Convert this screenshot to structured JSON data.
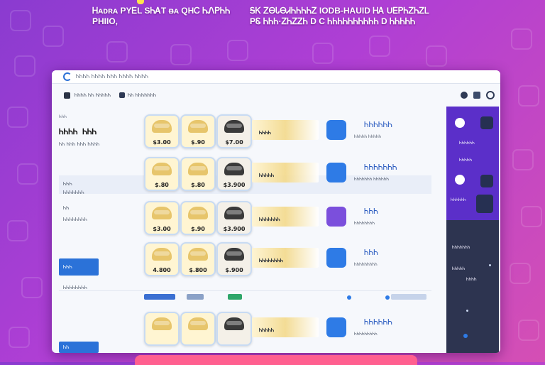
{
  "headline": {
    "left": "Ꮋᴀᴅʀᴀ PYᎬL SᏂᎪT ᴃᴀ QHᏟ ᏂᏁᏢᏂᏂ\nPHIIO,",
    "right": "ᎦᏦ ᏃᎾᏓᎾᏗᏂᏂᏂᏂᏃ   IODB-HAUID ᎻᎪ UᎬᏢᏂᏃᏂᏃᏞ\nPᏋ ᏂᏂᏂ·ᏃᏂᏃᏃᏂ D  C ᏂᏂᏂᏂᏂᏂᏂᏂᏂᏂ D ᏂᏂᏂᏂᏂ"
  },
  "window": {
    "title": "ᏂᏂᏂᏂ ᏂᏂᏂᏂ ᏂᏂᏂ ᏂᏂᏂᏂ ᏂᏂᏂᏂ",
    "toolbar_crumb": "ᏂᏂᏂᏂ  ᏂᏂ  ᏂᏂᏂᏂᏂ",
    "toolbar_label": "ᏂᏂ ᏂᏂᏂᏂᏂᏂᏂ"
  },
  "left": {
    "top_label": "ᏂᏂᏂ",
    "title": "ᏂᏂᏂᏂ ᏂᏂᏂ",
    "subtitle": "ᏂᏂ ᏂᏂᏂ ᏂᏂᏂ ᏂᏂᏂᏂ",
    "label2": "ᏂᏂᏂ",
    "sub2": "ᏂᏂᏂᏂᏂᏂᏂ",
    "label3": "ᏂᏂ",
    "sub3": "ᏂᏂᏂᏂᏂᏂᏂᏂ",
    "button": "ᏂᏂᏂ",
    "button2": "ᏂᏂ",
    "sub4": "ᏂᏂᏂᏂᏂᏂᏂᏂ"
  },
  "rows": [
    {
      "prices": [
        "$3.00",
        "$.90",
        "$7.00"
      ],
      "headline": "ᏂᏂᏂᏂ",
      "big": "ᏂᏂᏂᏂᏂᏂ",
      "small": "ᏂᏂᏂᏂᏂ ᏂᏂᏂᏂᏂ"
    },
    {
      "prices": [
        "$.80",
        "$.80",
        "$3.900"
      ],
      "headline": "ᏂᏂᏂᏂᏂ",
      "big": "ᏂᏂᏂᏂᏂᏂᏂ",
      "small": "ᏂᏂᏂᏂᏂᏂᏂ ᏂᏂᏂᏂᏂᏂ"
    },
    {
      "prices": [
        "$3.00",
        "$.90",
        "$3.900"
      ],
      "headline": "ᏂᏂᏂᏂᏂᏂᏂ",
      "big": "ᏂᏂᏂ",
      "small": "ᏂᏂᏂᏂᏂᏂᏂᏂ"
    },
    {
      "prices": [
        "4.800",
        "$.800",
        "$.900"
      ],
      "headline": "ᏂᏂᏂᏂᏂᏂᏂᏂ",
      "big": "ᏂᏂᏂ",
      "small": "ᏂᏂᏂᏂᏂᏂᏂᏂᏂ"
    },
    {
      "prices": [
        "",
        "",
        ""
      ],
      "headline": "ᏂᏂᏂᏂᏂ",
      "big": "ᏂᏂᏂᏂᏂᏂ",
      "small": "ᏂᏂᏂᏂᏂᏂᏂᏂᏂ"
    }
  ],
  "right": {
    "label1": "ᏂᏂᏂᏂᏂᏂ",
    "label2": "ᏂᏂᏂᏂᏂ",
    "label3": "ᏂᏂᏂᏂᏂᏂ",
    "label4": "ᏂᏂᏂᏂᏂᏂᏂ",
    "label5": "ᏂᏂᏂᏂᏂ",
    "label6": "ᏂᏂᏂᏂ"
  },
  "colors": {
    "background_start": "#8a3bd0",
    "background_end": "#d54fb4",
    "accent": "#2b72d8",
    "sidebar_purple": "#5b2fc9",
    "sidebar_dark": "#2d3450"
  }
}
